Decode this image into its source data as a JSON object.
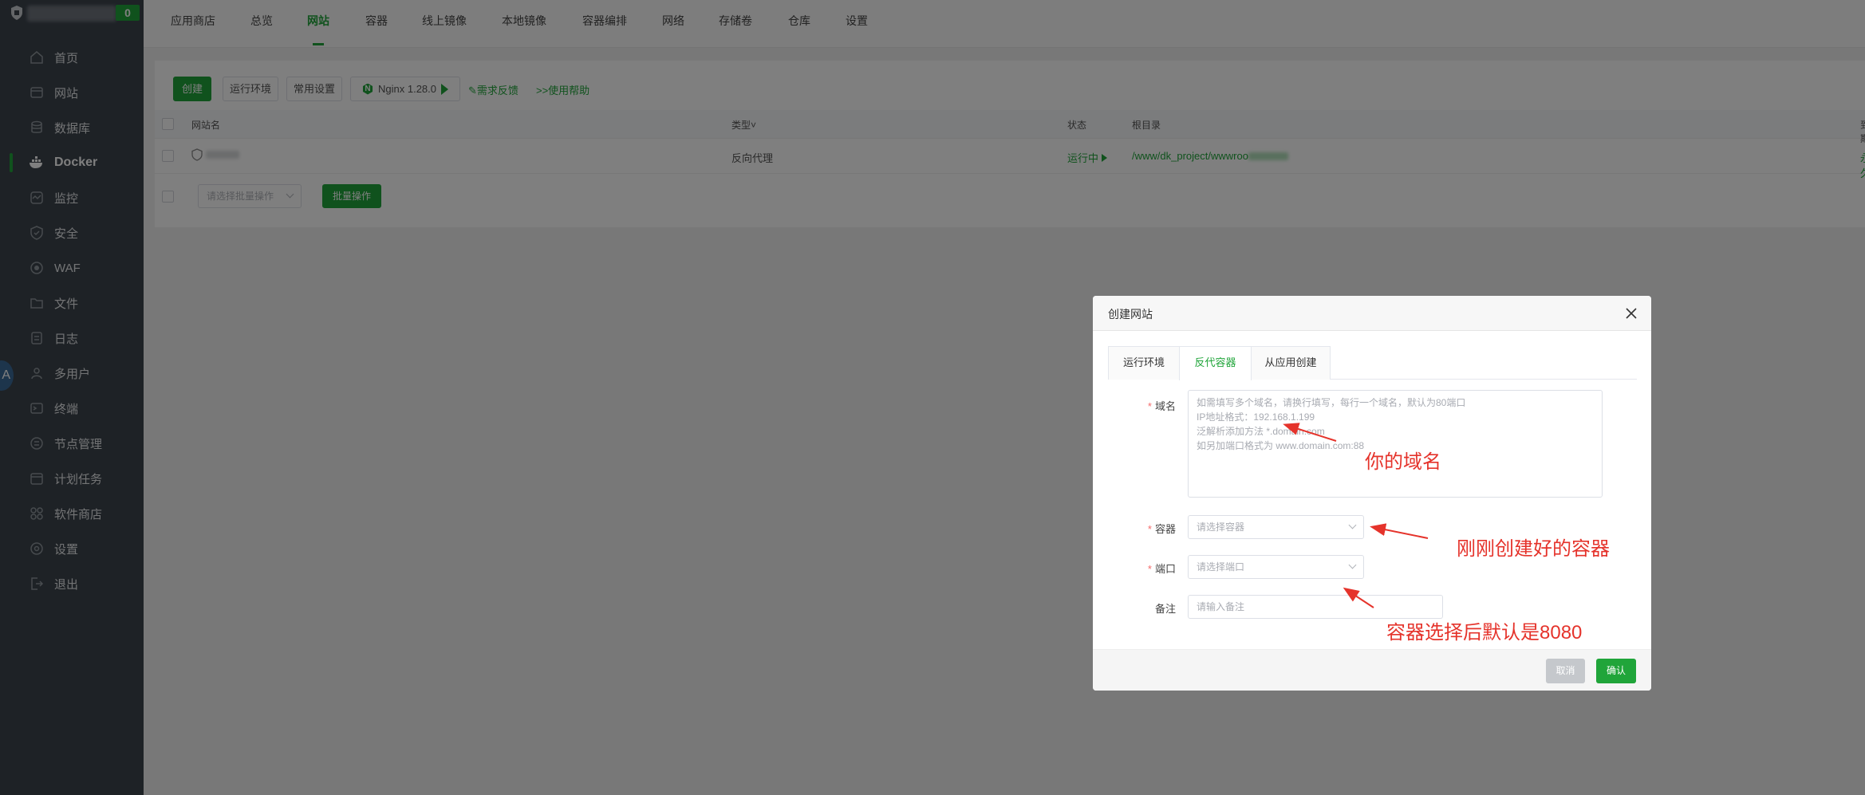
{
  "sidebar": {
    "badge": "0",
    "avatar_letter": "A",
    "items": [
      {
        "label": "首页",
        "icon": "home-icon"
      },
      {
        "label": "网站",
        "icon": "globe-icon"
      },
      {
        "label": "数据库",
        "icon": "database-icon"
      },
      {
        "label": "Docker",
        "icon": "docker-icon"
      },
      {
        "label": "监控",
        "icon": "monitor-icon"
      },
      {
        "label": "安全",
        "icon": "shield-icon"
      },
      {
        "label": "WAF",
        "icon": "waf-icon"
      },
      {
        "label": "文件",
        "icon": "folder-icon"
      },
      {
        "label": "日志",
        "icon": "log-icon"
      },
      {
        "label": "多用户",
        "icon": "users-icon"
      },
      {
        "label": "终端",
        "icon": "terminal-icon"
      },
      {
        "label": "节点管理",
        "icon": "nodes-icon"
      },
      {
        "label": "计划任务",
        "icon": "calendar-icon"
      },
      {
        "label": "软件商店",
        "icon": "apps-icon"
      },
      {
        "label": "设置",
        "icon": "gear-icon"
      },
      {
        "label": "退出",
        "icon": "logout-icon"
      }
    ]
  },
  "tabs": [
    "应用商店",
    "总览",
    "网站",
    "容器",
    "线上镜像",
    "本地镜像",
    "容器编排",
    "网络",
    "存储卷",
    "仓库",
    "设置"
  ],
  "toolbar": {
    "create": "创建",
    "runtime": "运行环境",
    "common_settings": "常用设置",
    "nginx": "Nginx 1.28.0",
    "feedback": "需求反馈",
    "help": ">>使用帮助"
  },
  "table": {
    "headers": {
      "name": "网站名",
      "type": "类型",
      "status": "状态",
      "root": "根目录",
      "expire": "到期"
    },
    "row": {
      "type": "反向代理",
      "status": "运行中",
      "root": "/www/dk_project/wwwroo",
      "expire": "永久"
    },
    "batch_placeholder": "请选择批量操作",
    "batch_button": "批量操作"
  },
  "dialog": {
    "title": "创建网站",
    "tabs": [
      "运行环境",
      "反代容器",
      "从应用创建"
    ],
    "domain": {
      "label": "域名",
      "placeholder_lines": [
        "如需填写多个域名，请换行填写，每行一个域名，默认为80端口",
        "IP地址格式：192.168.1.199",
        "泛解析添加方法 *.domain.com",
        "如另加端口格式为 www.domain.com:88"
      ]
    },
    "container": {
      "label": "容器",
      "placeholder": "请选择容器"
    },
    "port": {
      "label": "端口",
      "placeholder": "请选择端口"
    },
    "remark": {
      "label": "备注",
      "placeholder": "请输入备注"
    },
    "cancel": "取消",
    "confirm": "确认"
  },
  "annotations": {
    "domain": "你的域名",
    "container": "刚刚创建好的容器",
    "port": "容器选择后默认是8080"
  },
  "colors": {
    "brand": "#20a53a",
    "sidebar_bg": "#3c444d",
    "annotation": "#e5332b"
  }
}
